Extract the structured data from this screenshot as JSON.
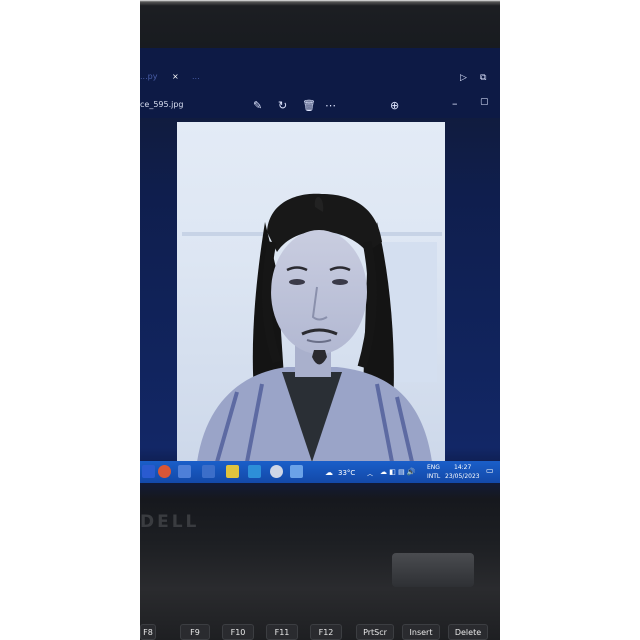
{
  "editor_tabs": {
    "tab1": "...py",
    "close": "×",
    "tab2": "..."
  },
  "viewer": {
    "filename": "ce_595.jpg"
  },
  "tray": {
    "weather": "33°C",
    "lang_line1": "ENG",
    "lang_line2": "INTL",
    "time": "14:27",
    "date": "23/05/2023"
  },
  "laptop": {
    "brand": "DELL"
  },
  "keyboard": {
    "keys": [
      "F8",
      "F9",
      "F10",
      "F11",
      "F12",
      "PrtScr",
      "Insert",
      "Delete"
    ]
  },
  "colors": {
    "screen_blue": "#0f1e4d",
    "taskbar_blue": "#1a5fc9",
    "photo_wall": "#dde6f3"
  }
}
